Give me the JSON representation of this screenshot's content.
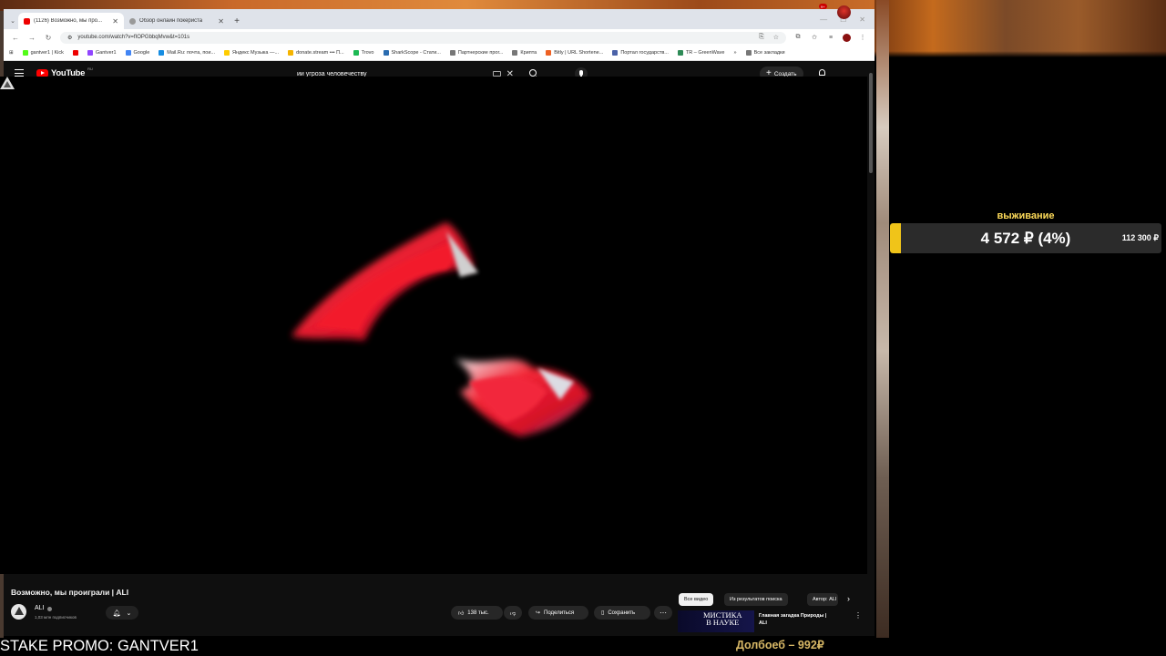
{
  "browser": {
    "tabs": [
      {
        "title": "(1126) Возможно, мы про..."
      },
      {
        "title": "Обзор онлайн покериста"
      }
    ],
    "new_tab": "+",
    "url": "youtube.com/watch?v=fIOPGbbqMvw&t=101s",
    "bookmarks": [
      "gantver1 | Kick",
      "Gantver1",
      "Google",
      "Mail.Ru: почта, пои...",
      "Яндекс Музыка —...",
      "donate.stream ••• П...",
      "Trovo",
      "SharkScope - Стати...",
      "Партнерские прог...",
      "Крипта",
      "Bitly | URL Shortene...",
      "Портал государств...",
      "TR – GreenWave"
    ],
    "all_bookmarks": "Все закладки"
  },
  "youtube": {
    "logo_text": "YouTube",
    "logo_region": "RU",
    "search_value": "ии угроза человечеству",
    "create_label": "Создать",
    "notification_count": "9+",
    "video_title": "Возможно, мы проиграли | ALI",
    "channel_name": "ALI",
    "subscribers": "1,03 млн подписчиков",
    "like_count": "138 тыс.",
    "share_label": "Поделиться",
    "save_label": "Сохранить",
    "chips": [
      "Все видео",
      "Из результатов поиска",
      "Автор: ALI"
    ],
    "rec_thumb_text_line1": "МИСТИКА",
    "rec_thumb_text_line2": "В НАУКЕ",
    "rec_title_line1": "Главная загадка Природы |",
    "rec_title_line2": "ALI"
  },
  "overlay": {
    "goal_title": "выживание",
    "goal_value": "4 572 ₽ (4%)",
    "goal_target": "112 300 ₽",
    "goal_progress": 0.04,
    "promo": "STAKE PROMO: GANTVER1",
    "donation": "Долбоеб – 992₽"
  },
  "colors": {
    "accent_red": "#ff0000",
    "goal_yellow": "#f0c419",
    "goal_title": "#ffdc5a",
    "donation_gold": "#d8b866"
  }
}
